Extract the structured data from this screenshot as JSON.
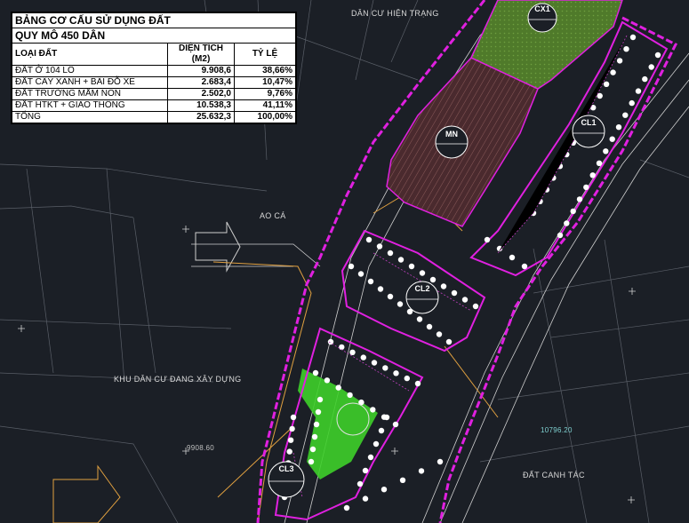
{
  "legend": {
    "title": "BẢNG CƠ CẤU SỬ DỤNG ĐẤT",
    "subtitle": "QUY MÔ 450 DÂN",
    "columns": [
      "LOẠI ĐẤT",
      "DIỆN TÍCH (M2)",
      "TỶ LỆ"
    ],
    "rows": [
      {
        "type": "ĐẤT Ở 104 LÔ",
        "area": "9.908,6",
        "ratio": "38,66%"
      },
      {
        "type": "ĐẤT CÂY XANH + BÃI ĐỖ XE",
        "area": "2.683,4",
        "ratio": "10,47%"
      },
      {
        "type": "ĐẤT TRƯỜNG MẦM NON",
        "area": "2.502,0",
        "ratio": "9,76%"
      },
      {
        "type": "ĐẤT HTKT + GIAO THÔNG",
        "area": "10.538,3",
        "ratio": "41,11%"
      },
      {
        "type": "TỔNG",
        "area": "25.632,3",
        "ratio": "100,00%"
      }
    ]
  },
  "labels": {
    "dan_cu_hien_trang": "DÂN CƯ HIỆN TRẠNG",
    "ao_ca": "AO CÁ",
    "khu_dan_cu": "KHU DÂN CƯ ĐANG XÂY DỰNG",
    "dat_canh_tac": "ĐẤT CANH TÁC",
    "elev_left": "9908.60",
    "elev_right": "10796.20"
  },
  "plots": {
    "cx1": "CX1",
    "mn": "MN",
    "cl1": "CL1",
    "cl2": "CL2",
    "cl3": "CL3"
  },
  "colors": {
    "background": "#1b1f26",
    "boundary": "#e020e0",
    "road": "#e0a040",
    "green": "#3ecf2a",
    "school": "#6b3a3a",
    "lot": "#ffffff"
  }
}
